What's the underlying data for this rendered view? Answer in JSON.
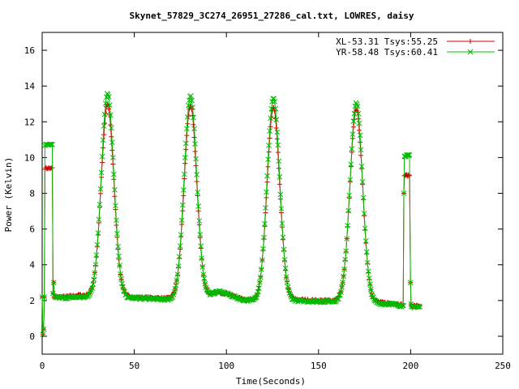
{
  "chart_data": {
    "type": "line",
    "title": "Skynet_57829_3C274_26951_27286_cal.txt, LOWRES, daisy",
    "xlabel": "Time(Seconds)",
    "ylabel": "Power (Kelvin)",
    "xlim": [
      0,
      250
    ],
    "ylim": [
      -1,
      17
    ],
    "xticks": [
      0,
      50,
      100,
      150,
      200,
      250
    ],
    "yticks": [
      0,
      2,
      4,
      6,
      8,
      10,
      12,
      14,
      16
    ],
    "grid": false,
    "legend_position": "top-right",
    "series": [
      {
        "name": "XL-53.31 Tsys:55.25",
        "color": "#cc0000",
        "marker": "plus",
        "cal_on": 9.4,
        "cal_on_end": 9.0,
        "baseline": [
          [
            6,
            2.2
          ],
          [
            12,
            2.2
          ],
          [
            20,
            2.3
          ],
          [
            28,
            2.25
          ],
          [
            45,
            2.2
          ],
          [
            60,
            2.15
          ],
          [
            70,
            2.1
          ],
          [
            88,
            2.2
          ],
          [
            95,
            2.45
          ],
          [
            100,
            2.4
          ],
          [
            108,
            2.1
          ],
          [
            118,
            2.0
          ],
          [
            135,
            2.05
          ],
          [
            150,
            2.0
          ],
          [
            165,
            2.0
          ],
          [
            180,
            1.9
          ],
          [
            190,
            1.85
          ],
          [
            196,
            1.75
          ]
        ],
        "peaks": [
          {
            "x": 35.5,
            "y": 12.9,
            "width": 3.4
          },
          {
            "x": 80.5,
            "y": 12.9,
            "width": 3.4
          },
          {
            "x": 125.5,
            "y": 12.9,
            "width": 3.4
          },
          {
            "x": 170.5,
            "y": 12.9,
            "width": 3.4
          }
        ],
        "tail_level": 1.7
      },
      {
        "name": "YR-58.48 Tsys:60.41",
        "color": "#00bb00",
        "marker": "x",
        "cal_on": 10.7,
        "cal_on_end": 10.1,
        "baseline": [
          [
            6,
            2.2
          ],
          [
            12,
            2.15
          ],
          [
            20,
            2.2
          ],
          [
            28,
            2.15
          ],
          [
            45,
            2.15
          ],
          [
            60,
            2.1
          ],
          [
            70,
            2.05
          ],
          [
            88,
            2.15
          ],
          [
            95,
            2.5
          ],
          [
            100,
            2.4
          ],
          [
            108,
            2.05
          ],
          [
            118,
            1.95
          ],
          [
            135,
            2.0
          ],
          [
            150,
            1.95
          ],
          [
            165,
            1.95
          ],
          [
            180,
            1.85
          ],
          [
            190,
            1.8
          ],
          [
            196,
            1.7
          ]
        ],
        "peaks": [
          {
            "x": 35.5,
            "y": 13.6,
            "width": 3.4
          },
          {
            "x": 80.5,
            "y": 13.5,
            "width": 3.4
          },
          {
            "x": 125.5,
            "y": 13.5,
            "width": 3.4
          },
          {
            "x": 170.5,
            "y": 13.3,
            "width": 3.4
          }
        ],
        "tail_level": 1.65
      }
    ]
  }
}
